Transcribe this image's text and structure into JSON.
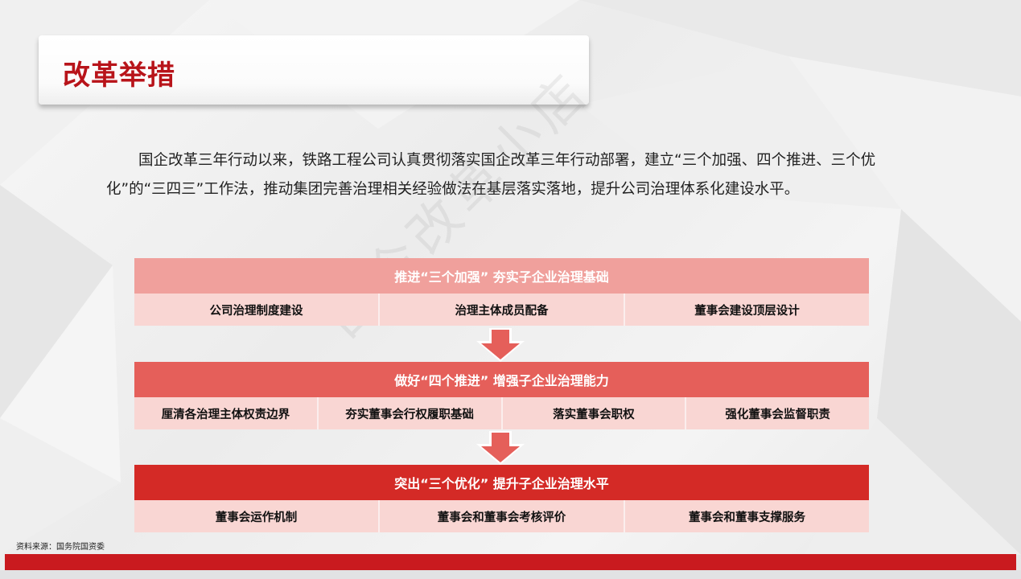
{
  "title": "改革举措",
  "intro": "国企改革三年行动以来，铁路工程公司认真贯彻落实国企改革三年行动部署，建立“三个加强、四个推进、三个优化”的“三四三”工作法，推动集团完善治理相关经验做法在基层落实落地，提升公司治理体系化建设水平。",
  "sections": [
    {
      "header": "推进“三个加强” 夯实子企业治理基础",
      "items": [
        "公司治理制度建设",
        "治理主体成员配备",
        "董事会建设顶层设计"
      ]
    },
    {
      "header": "做好“四个推进” 增强子企业治理能力",
      "items": [
        "厘清各治理主体权责边界",
        "夯实董事会行权履职基础",
        "落实董事会职权",
        "强化董事会监督职责"
      ]
    },
    {
      "header": "突出“三个优化” 提升子企业治理水平",
      "items": [
        "董事会运作机制",
        "董事会和董事会考核评价",
        "董事会和董事支撑服务"
      ]
    }
  ],
  "source": "资料来源：国务院国资委",
  "watermark": "国企改革小店",
  "colors": {
    "title": "#b8141a",
    "header1": "#f0a09c",
    "header2": "#e55f5a",
    "header3": "#d42a26",
    "row": "#f9d6d3",
    "bottom_bar": "#c91a1f"
  }
}
